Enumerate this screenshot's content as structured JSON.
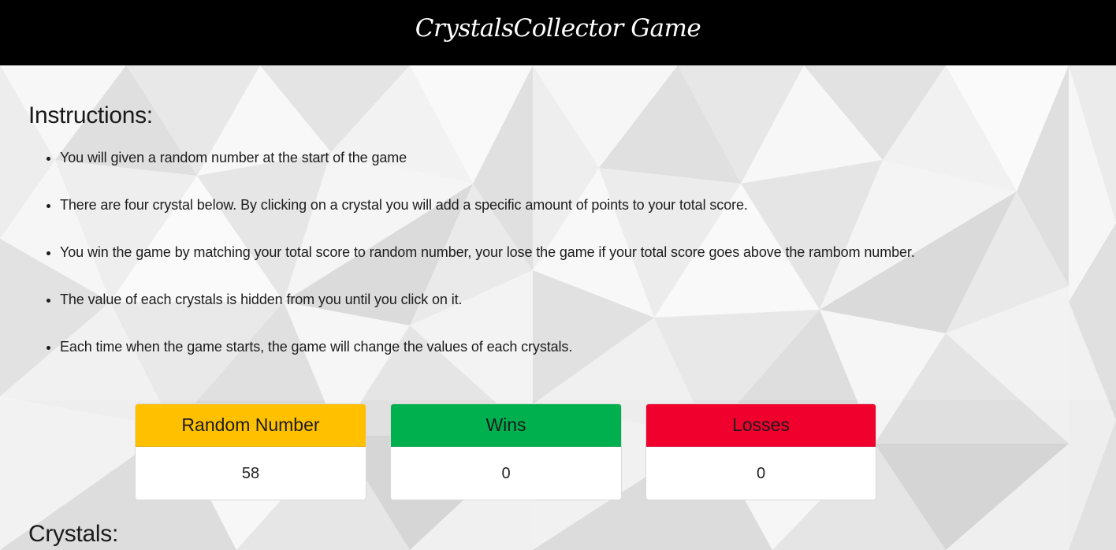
{
  "header": {
    "title": "CrystalsCollector Game"
  },
  "instructions": {
    "heading": "Instructions:",
    "items": [
      "You will given a random number at the start of the game",
      "There are four crystal below. By clicking on a crystal you will add a specific amount of points to your total score.",
      "You win the game by matching your total score to random number, your lose the game if your total score goes above the rambom number.",
      "The value of each crystals is hidden from you until you click on it.",
      "Each time when the game starts, the game will change the values of each crystals."
    ]
  },
  "scoreboard": {
    "random_number": {
      "label": "Random Number",
      "value": "58",
      "color": "#ffc000"
    },
    "wins": {
      "label": "Wins",
      "value": "0",
      "color": "#00b04f"
    },
    "losses": {
      "label": "Losses",
      "value": "0",
      "color": "#f0002d"
    }
  },
  "crystals": {
    "heading": "Crystals:"
  },
  "theme": {
    "header_background": "#000000",
    "header_text": "#ffffff",
    "background_style": "white low-poly crystal pattern"
  }
}
